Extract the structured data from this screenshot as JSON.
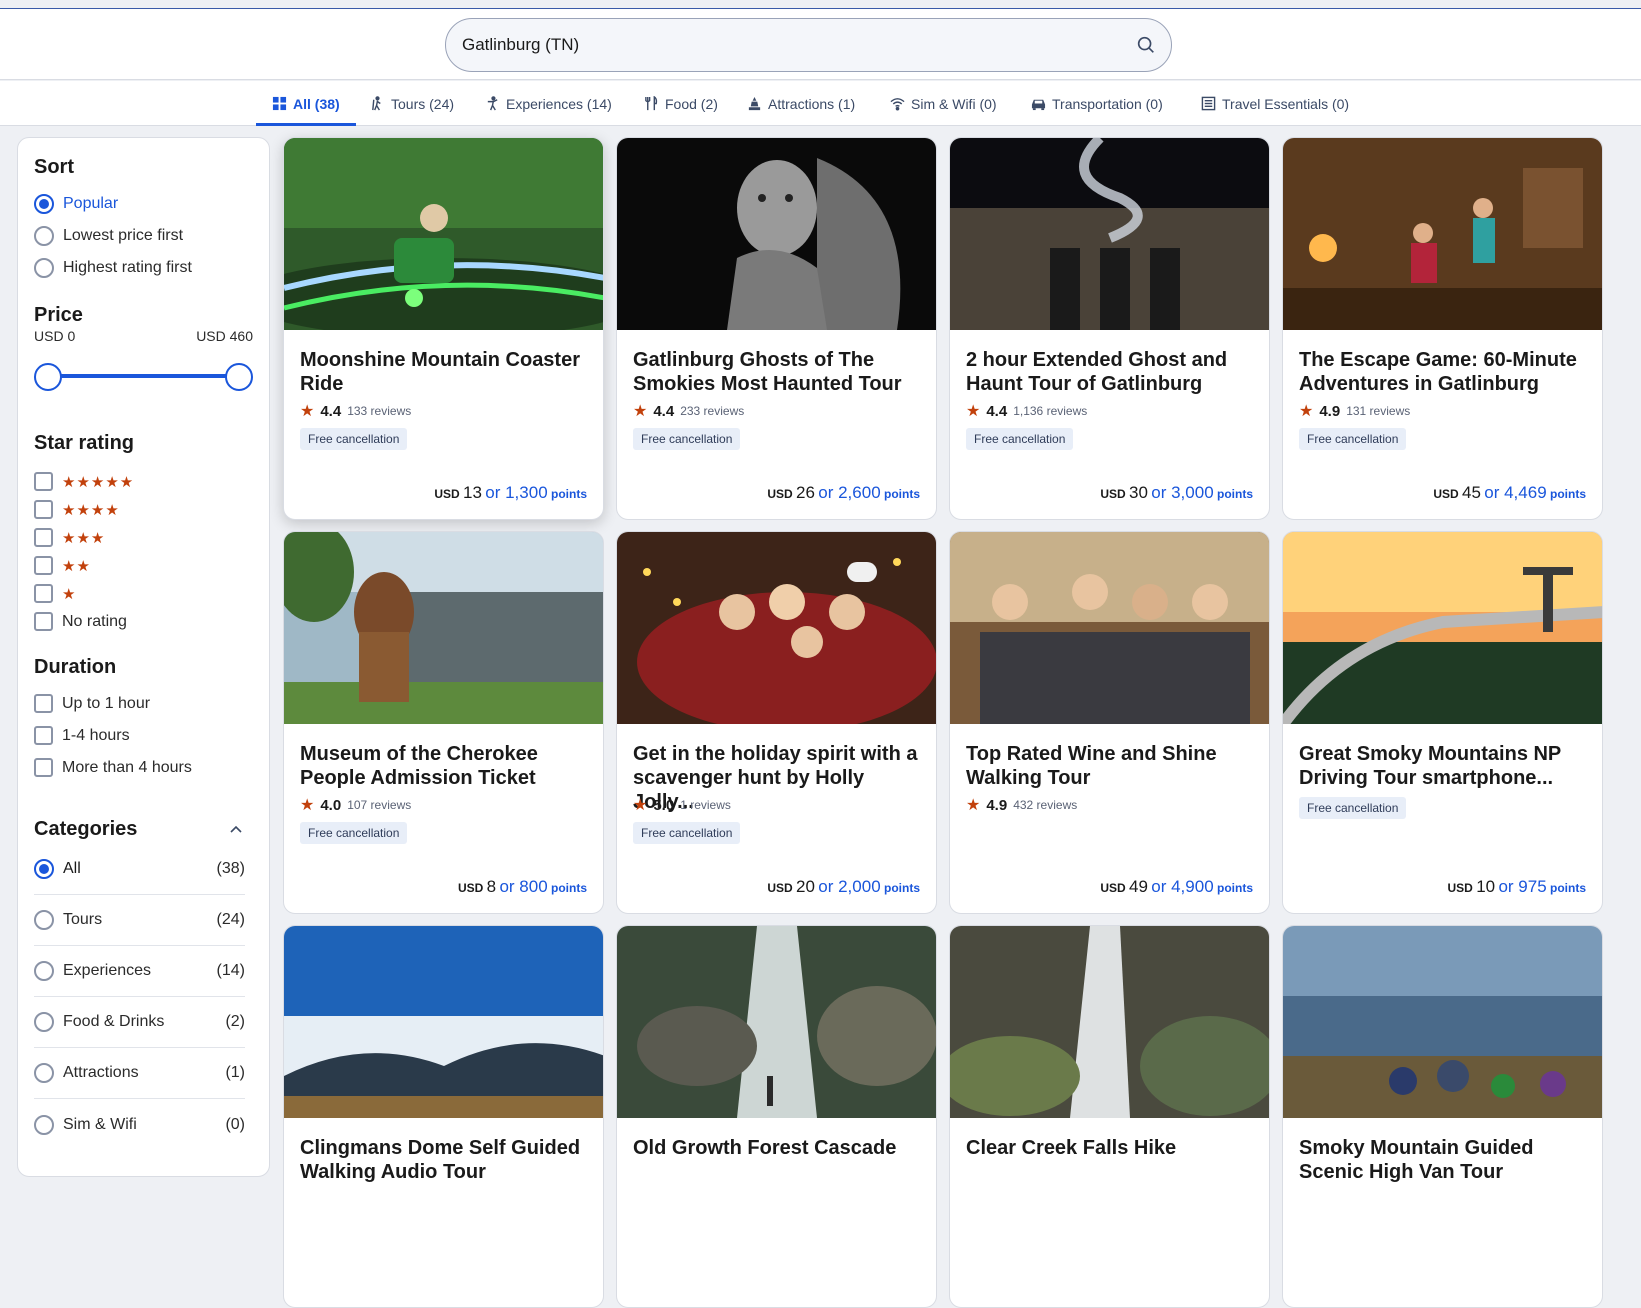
{
  "search": {
    "value": "Gatlinburg (TN)"
  },
  "tabs": [
    {
      "label": "All (38)",
      "icon": "grid-icon",
      "active": true
    },
    {
      "label": "Tours (24)",
      "icon": "hiker-icon"
    },
    {
      "label": "Experiences (14)",
      "icon": "person-icon"
    },
    {
      "label": "Food (2)",
      "icon": "utensils-icon"
    },
    {
      "label": "Attractions (1)",
      "icon": "landmark-icon"
    },
    {
      "label": "Sim & Wifi (0)",
      "icon": "wifi-icon"
    },
    {
      "label": "Transportation (0)",
      "icon": "car-icon"
    },
    {
      "label": "Travel Essentials (0)",
      "icon": "list-icon"
    }
  ],
  "sidebar": {
    "sort_heading": "Sort",
    "sort_options": [
      "Popular",
      "Lowest price first",
      "Highest rating first"
    ],
    "sort_selected": "Popular",
    "price_heading": "Price",
    "price_min": "USD 0",
    "price_max": "USD 460",
    "star_heading": "Star rating",
    "star_options": [
      "★★★★★",
      "★★★★",
      "★★★",
      "★★",
      "★"
    ],
    "no_rating": "No rating",
    "duration_heading": "Duration",
    "duration_options": [
      "Up to 1 hour",
      "1-4 hours",
      "More than 4 hours"
    ],
    "categories_heading": "Categories",
    "categories": [
      {
        "label": "All",
        "count": "(38)"
      },
      {
        "label": "Tours",
        "count": "(24)"
      },
      {
        "label": "Experiences",
        "count": "(14)"
      },
      {
        "label": "Food & Drinks",
        "count": "(2)"
      },
      {
        "label": "Attractions",
        "count": "(1)"
      },
      {
        "label": "Sim & Wifi",
        "count": "(0)"
      }
    ],
    "category_selected": "All"
  },
  "cards": [
    {
      "title": "Moonshine Mountain Coaster Ride",
      "rating": "4.4",
      "reviews": "133 reviews",
      "badge": "Free cancellation",
      "currency": "USD",
      "price": "13",
      "points": "or 1,300",
      "points_label": "points"
    },
    {
      "title": "Gatlinburg Ghosts of The Smokies Most Haunted Tour",
      "rating": "4.4",
      "reviews": "233 reviews",
      "badge": "Free cancellation",
      "currency": "USD",
      "price": "26",
      "points": "or 2,600",
      "points_label": "points"
    },
    {
      "title": "2 hour Extended Ghost and Haunt Tour of Gatlinburg",
      "rating": "4.4",
      "reviews": "1,136 reviews",
      "badge": "Free cancellation",
      "currency": "USD",
      "price": "30",
      "points": "or 3,000",
      "points_label": "points"
    },
    {
      "title": "The Escape Game: 60-Minute Adventures in Gatlinburg",
      "rating": "4.9",
      "reviews": "131 reviews",
      "badge": "Free cancellation",
      "currency": "USD",
      "price": "45",
      "points": "or 4,469",
      "points_label": "points"
    },
    {
      "title": "Museum of the Cherokee People Admission Ticket",
      "rating": "4.0",
      "reviews": "107 reviews",
      "badge": "Free cancellation",
      "currency": "USD",
      "price": "8",
      "points": "or 800",
      "points_label": "points"
    },
    {
      "title": "Get in the holiday spirit with a scavenger hunt by Holly Jolly...",
      "rating": "5.0",
      "reviews": "1 reviews",
      "badge": "Free cancellation",
      "currency": "USD",
      "price": "20",
      "points": "or 2,000",
      "points_label": "points"
    },
    {
      "title": "Top Rated Wine and Shine Walking Tour",
      "rating": "4.9",
      "reviews": "432 reviews",
      "badge": "",
      "currency": "USD",
      "price": "49",
      "points": "or 4,900",
      "points_label": "points"
    },
    {
      "title": "Great Smoky Mountains NP Driving Tour smartphone...",
      "rating": "",
      "reviews": "",
      "badge": "Free cancellation",
      "currency": "USD",
      "price": "10",
      "points": "or 975",
      "points_label": "points"
    },
    {
      "title": "Clingmans Dome Self Guided Walking Audio Tour",
      "rating": "",
      "reviews": "",
      "badge": "",
      "currency": "",
      "price": "",
      "points": "",
      "points_label": ""
    },
    {
      "title": "Old Growth Forest Cascade",
      "rating": "",
      "reviews": "",
      "badge": "",
      "currency": "",
      "price": "",
      "points": "",
      "points_label": ""
    },
    {
      "title": "Clear Creek Falls Hike",
      "rating": "",
      "reviews": "",
      "badge": "",
      "currency": "",
      "price": "",
      "points": "",
      "points_label": ""
    },
    {
      "title": "Smoky Mountain Guided Scenic High Van Tour",
      "rating": "",
      "reviews": "",
      "badge": "",
      "currency": "",
      "price": "",
      "points": "",
      "points_label": ""
    }
  ],
  "colors": {
    "accent": "#1a56db",
    "star": "#c2410c",
    "badge_bg": "#e8eef8"
  }
}
